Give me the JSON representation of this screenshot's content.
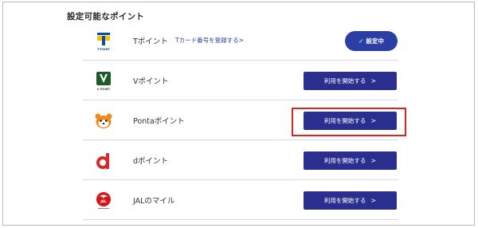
{
  "section": {
    "title": "設定可能なポイント"
  },
  "points": [
    {
      "key": "t",
      "name": "Tポイント",
      "sublink": "Tカード番号を登録する>",
      "button": {
        "label": "設定中",
        "state": "set"
      },
      "logo_text": "T-POINT"
    },
    {
      "key": "v",
      "name": "Vポイント",
      "button": {
        "label": "利用を開始する",
        "chevron": ">"
      },
      "logo_text": "V POINT"
    },
    {
      "key": "ponta",
      "name": "Pontaポイント",
      "button": {
        "label": "利用を開始する",
        "chevron": ">"
      }
    },
    {
      "key": "d",
      "name": "dポイント",
      "button": {
        "label": "利用を開始する",
        "chevron": ">"
      }
    },
    {
      "key": "jal",
      "name": "JALのマイル",
      "button": {
        "label": "利用を開始する",
        "chevron": ">"
      },
      "logo_text": "JAL"
    }
  ],
  "check_glyph": "✓",
  "colors": {
    "button_primary": "#2a2e8f",
    "button_set": "#2a3ea5",
    "highlight": "#d8261f",
    "link": "#2b3f9a"
  }
}
